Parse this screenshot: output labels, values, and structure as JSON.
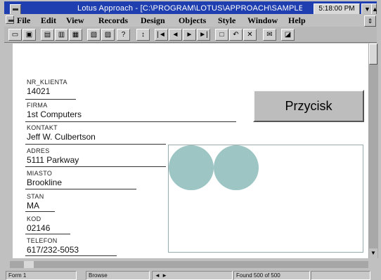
{
  "window": {
    "title": "Lotus Approach - [C:\\PROGRAM\\LOTUS\\APPROACH\\SAMPLE\\CLIENT.VEW]",
    "clock": "5:18:00 PM"
  },
  "menu": {
    "items": [
      "File",
      "Edit",
      "View",
      "Records",
      "Design",
      "Objects",
      "Style",
      "Window",
      "Help"
    ]
  },
  "toolbar": {
    "nav_first": "|◄",
    "nav_prev": "◄",
    "nav_next": "►",
    "nav_last": "►|"
  },
  "form": {
    "fields": [
      {
        "label": "NR_KLIENTA",
        "value": "14021"
      },
      {
        "label": "FIRMA",
        "value": "1st Computers"
      },
      {
        "label": "KONTAKT",
        "value": "Jeff W. Culbertson"
      },
      {
        "label": "ADRES",
        "value": "5111 Parkway"
      },
      {
        "label": "MIASTO",
        "value": "Brookline"
      },
      {
        "label": "STAN",
        "value": "MA"
      },
      {
        "label": "KOD",
        "value": "02146"
      },
      {
        "label": "TELEFON",
        "value": "617/232-5053"
      }
    ],
    "button_label": "Przycisk"
  },
  "status": {
    "form_name": "Form 1",
    "mode": "Browse",
    "found": "Found 500 of 500"
  },
  "colors": {
    "titlebar": "#1f3fb0",
    "circle": "#9cc5c4"
  }
}
